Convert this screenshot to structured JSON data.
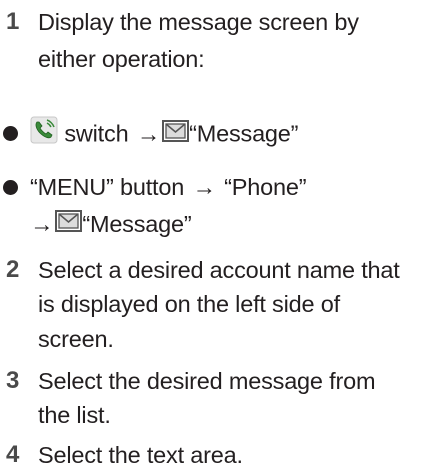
{
  "steps": [
    {
      "number": "1",
      "lines": [
        "Display the message screen by",
        "either operation:"
      ]
    },
    {
      "number": "2",
      "lines": [
        "Select a desired account name that",
        "is displayed on the left side of",
        "screen."
      ]
    },
    {
      "number": "3",
      "lines": [
        "Select the desired message from",
        "the list."
      ]
    },
    {
      "number": "4",
      "lines": [
        "Select the text area."
      ]
    }
  ],
  "bullets": [
    {
      "phone_switch_text": "switch",
      "arrow": "→",
      "message_label": "“Message”"
    },
    {
      "menu_text": "“MENU” button",
      "arrow": "→",
      "phone_text": "“Phone”",
      "arrow2": "→",
      "message_label": "“Message”"
    }
  ],
  "icons": {
    "phone": "phone-switch-icon",
    "message": "message-envelope-icon"
  },
  "colors": {
    "text": "#231f20",
    "step_number": "#4a4a4a",
    "icon_green": "#3a8a3a"
  }
}
